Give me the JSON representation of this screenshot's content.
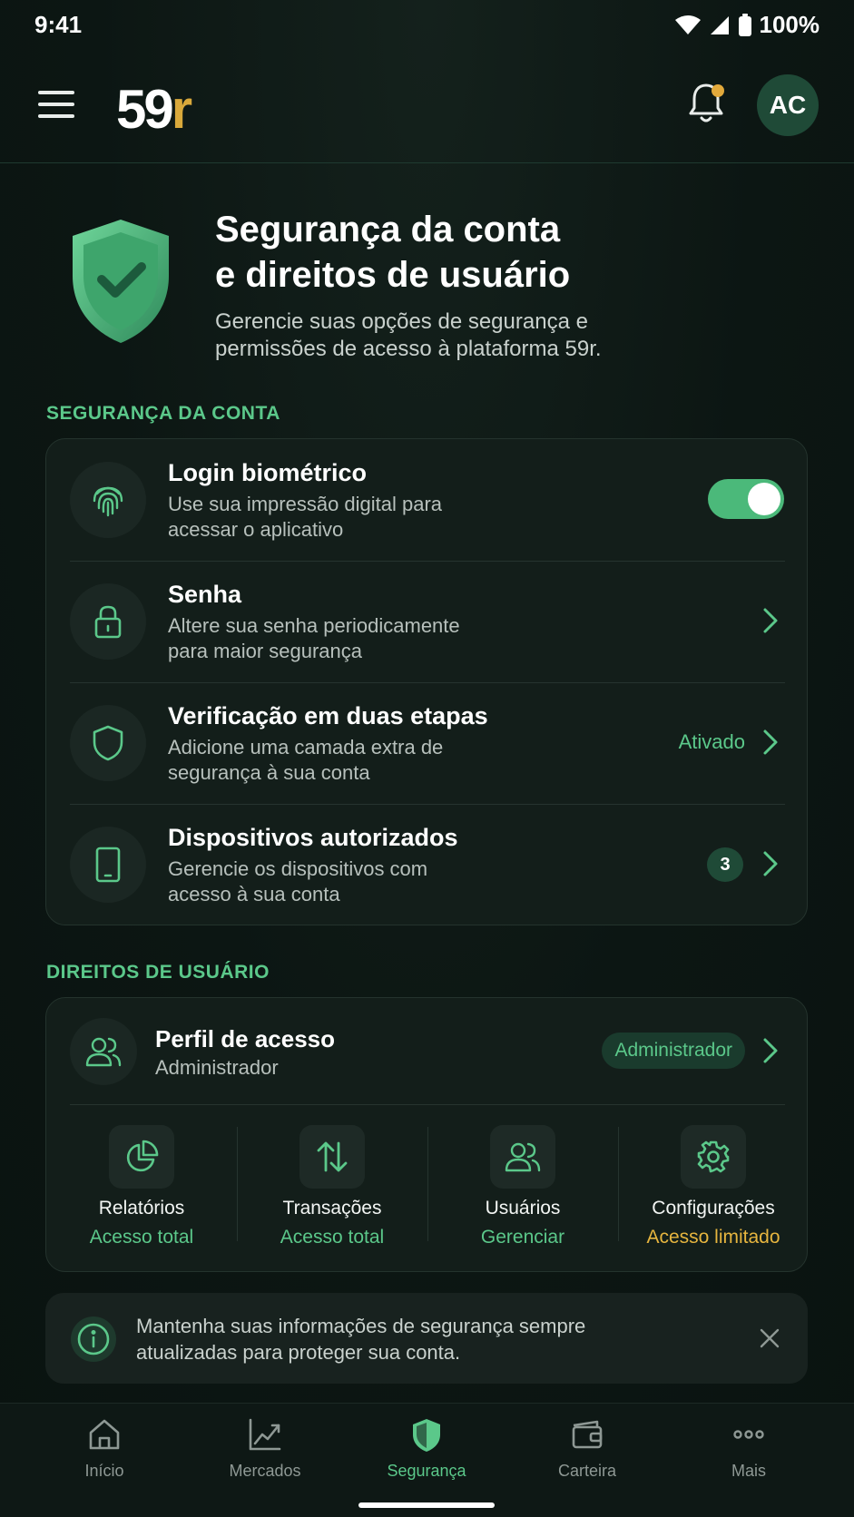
{
  "status_bar": {
    "time": "9:41",
    "battery": "100%"
  },
  "header": {
    "logo_number": "59",
    "logo_letter": "r",
    "avatar_initials": "AC"
  },
  "hero": {
    "title_line1": "Segurança da conta",
    "title_line2": "e direitos de usuário",
    "subtitle_line1": "Gerencie suas opções de segurança e",
    "subtitle_line2": "permissões de acesso à plataforma 59r."
  },
  "security": {
    "section_title": "SEGURANÇA DA CONTA",
    "items": [
      {
        "title": "Login biométrico",
        "desc_line1": "Use sua impressão digital para",
        "desc_line2": "acessar o aplicativo",
        "icon": "fingerprint-icon",
        "toggle_on": true
      },
      {
        "title": "Senha",
        "desc_line1": "Altere sua senha periodicamente",
        "desc_line2": "para maior segurança",
        "icon": "lock-icon"
      },
      {
        "title": "Verificação em duas etapas",
        "desc_line1": "Adicione uma camada extra de",
        "desc_line2": "segurança à sua conta",
        "icon": "shield-icon",
        "status": "Ativado"
      },
      {
        "title": "Dispositivos autorizados",
        "desc_line1": "Gerencie os dispositivos com",
        "desc_line2": "acesso à sua conta",
        "icon": "tablet-icon",
        "count": "3"
      }
    ]
  },
  "rights": {
    "section_title": "DIREITOS DE USUÁRIO",
    "profile": {
      "title": "Perfil de acesso",
      "subtitle": "Administrador",
      "role": "Administrador"
    },
    "permissions": [
      {
        "name": "Relatórios",
        "level": "Acesso total",
        "icon": "pie-chart-icon"
      },
      {
        "name": "Transações",
        "level": "Acesso total",
        "icon": "swap-arrows-icon"
      },
      {
        "name": "Usuários",
        "level": "Gerenciar",
        "icon": "users-icon"
      },
      {
        "name": "Configurações",
        "level": "Acesso limitado",
        "icon": "gear-icon"
      }
    ]
  },
  "info": {
    "line1": "Mantenha suas informações de segurança sempre",
    "line2": "atualizadas para proteger sua conta."
  },
  "nav": {
    "items": [
      {
        "label": "Início",
        "icon": "home-icon"
      },
      {
        "label": "Mercados",
        "icon": "chart-icon"
      },
      {
        "label": "Segurança",
        "icon": "shield-icon",
        "active": true
      },
      {
        "label": "Carteira",
        "icon": "wallet-icon"
      },
      {
        "label": "Mais",
        "icon": "more-icon"
      }
    ]
  },
  "colors": {
    "accent": "#5bc88a",
    "warning": "#e6b53f",
    "logo_accent": "#d9a93b",
    "background": "#0b1512"
  }
}
